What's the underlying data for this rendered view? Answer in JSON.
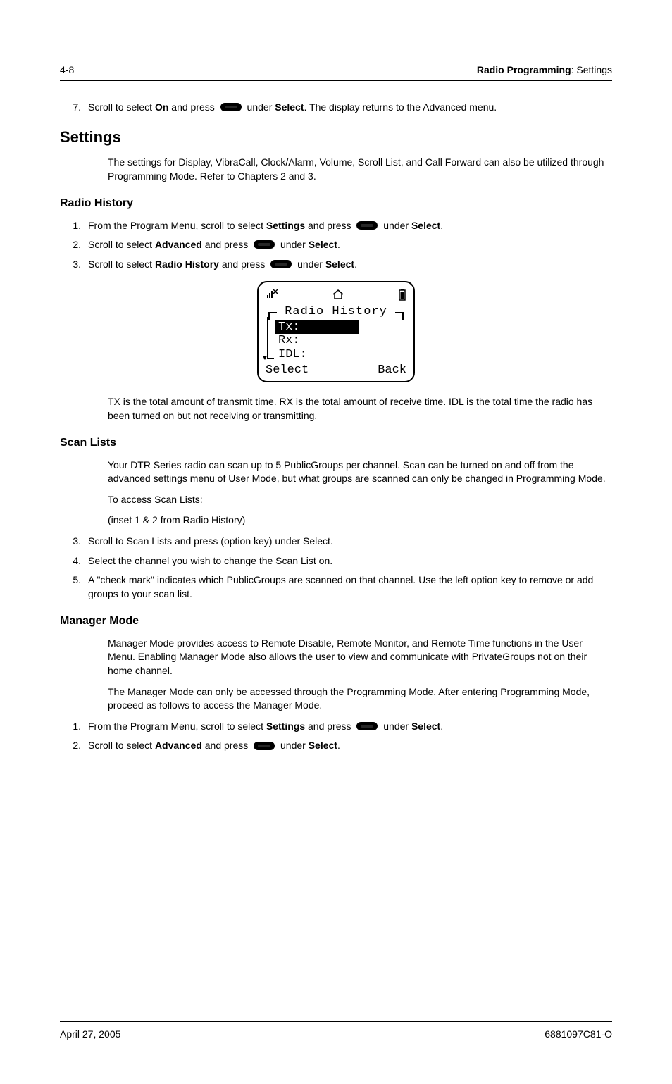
{
  "header": {
    "page_number": "4-8",
    "section_bold": "Radio Programming",
    "section_plain": ": Settings"
  },
  "step7": {
    "num": "7.",
    "t1": "Scroll to select ",
    "on": "On",
    "t2": " and press ",
    "t3": " under ",
    "select": "Select",
    "t4": ". The display returns to the Advanced menu."
  },
  "settings": {
    "heading": "Settings",
    "intro": "The settings for Display, VibraCall, Clock/Alarm, Volume, Scroll List, and Call Forward can also be utilized through Programming Mode. Refer to Chapters 2 and 3."
  },
  "radio_history": {
    "heading": "Radio History",
    "s1": {
      "num": "1.",
      "a": "From the Program Menu, scroll to select ",
      "b1": "Settings",
      "c": " and press ",
      "d": " under ",
      "b2": "Select",
      "e": "."
    },
    "s2": {
      "num": "2.",
      "a": "Scroll to select ",
      "b1": "Advanced",
      "c": " and press ",
      "d": " under ",
      "b2": "Select",
      "e": "."
    },
    "s3": {
      "num": "3.",
      "a": "Scroll to select ",
      "b1": "Radio History",
      "c": " and press ",
      "d": " under ",
      "b2": "Select",
      "e": "."
    },
    "note": "TX is the total amount of transmit time. RX is the total amount of receive time. IDL is the total time the radio has been turned on but not receiving or transmitting."
  },
  "screen": {
    "title": "Radio History",
    "tx": "Tx:",
    "rx": "Rx:",
    "idl": "IDL:",
    "select": "Select",
    "back": "Back"
  },
  "scan_lists": {
    "heading": "Scan Lists",
    "p1": "Your DTR Series radio can scan up to 5 PublicGroups per channel. Scan can be turned on and off from the advanced settings menu of User Mode, but what groups are scanned can only be changed in Programming Mode.",
    "p2": "To access Scan Lists:",
    "p3": "(inset 1 & 2 from Radio History)",
    "s3": {
      "num": "3.",
      "text": "Scroll to Scan Lists and press (option key) under Select."
    },
    "s4": {
      "num": "4.",
      "text": "Select the channel you wish to change the Scan List on."
    },
    "s5": {
      "num": "5.",
      "text": "A \"check mark\" indicates which PublicGroups are scanned on that channel. Use the left option key to remove or add groups to your scan list."
    }
  },
  "manager_mode": {
    "heading": "Manager Mode",
    "p1": "Manager Mode provides access to Remote Disable, Remote Monitor, and Remote Time functions in the User Menu. Enabling Manager Mode also allows the user to view and communicate with PrivateGroups not on their home channel.",
    "p2": "The Manager Mode can only be accessed through the Programming Mode. After entering Programming Mode, proceed as follows to access the Manager Mode.",
    "s1": {
      "num": "1.",
      "a": "From the Program Menu, scroll to select ",
      "b1": "Settings",
      "c": " and press ",
      "d": " under ",
      "b2": "Select",
      "e": "."
    },
    "s2": {
      "num": "2.",
      "a": "Scroll to select ",
      "b1": "Advanced",
      "c": " and press ",
      "d": " under ",
      "b2": "Select",
      "e": "."
    }
  },
  "footer": {
    "date": "April 27, 2005",
    "docnum": "6881097C81-O"
  }
}
